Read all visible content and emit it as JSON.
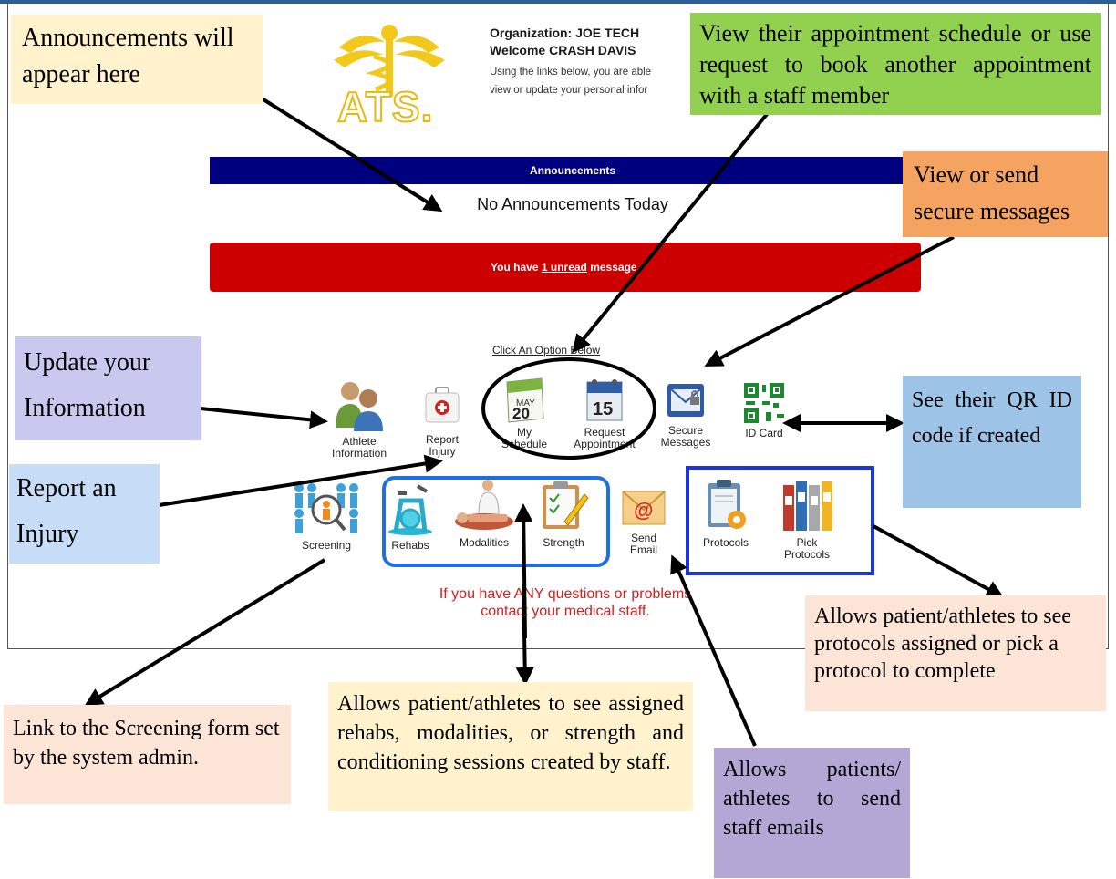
{
  "header": {
    "organization": "Organization: JOE TECH",
    "welcome": "Welcome CRASH DAVIS",
    "intro_line1": "Using the links below, you are able",
    "intro_line2": "view or update your personal infor"
  },
  "logo": {
    "text": "ATS."
  },
  "announcements": {
    "heading": "Announcements",
    "text": "No Announcements Today"
  },
  "messages": {
    "prefix": "You have ",
    "link": "1 unread",
    "suffix": " message."
  },
  "click_option": "Click An Option Below",
  "options_row1": [
    {
      "label": "Athlete\nInformation",
      "icon": "athlete-info-icon"
    },
    {
      "label": "Report\nInjury",
      "icon": "first-aid-kit-icon"
    },
    {
      "label": "My\nSchedule",
      "icon": "calendar-may-20-icon"
    },
    {
      "label": "Request\nAppointment",
      "icon": "calendar-15-icon"
    },
    {
      "label": "Secure\nMessages",
      "icon": "secure-envelope-icon"
    },
    {
      "label": "ID Card",
      "icon": "qr-code-icon"
    }
  ],
  "options_row2": [
    {
      "label": "Screening",
      "icon": "screening-people-icon"
    },
    {
      "label": "Rehabs",
      "icon": "exercise-bike-icon"
    },
    {
      "label": "Modalities",
      "icon": "doctor-patient-icon"
    },
    {
      "label": "Strength",
      "icon": "clipboard-pencil-icon"
    },
    {
      "label": "Send\nEmail",
      "icon": "email-at-icon"
    },
    {
      "label": "Protocols",
      "icon": "protocol-clipboard-icon"
    },
    {
      "label": "Pick\nProtocols",
      "icon": "binders-icon"
    }
  ],
  "contact": {
    "line1": "If you have ANY questions or problems",
    "line2": "contact your medical staff."
  },
  "callouts": {
    "announcements": "Announcements will appear here",
    "schedule": "View their appointment schedule or use request to book another appointment with a staff member",
    "messages": "View or send secure messages",
    "update": "Update your Information",
    "qr": "See their QR ID code if created",
    "injury": "Report an Injury",
    "protocols": "Allows patient/athletes to see protocols assigned or pick a protocol to complete",
    "screening": "Link to the Screening form set by the system admin.",
    "rehabs": "Allows patient/athletes to see assigned rehabs, modalities, or strength and conditioning sessions created by staff.",
    "email": "Allows patients/ athletes to send staff emails"
  },
  "colors": {
    "announcement_bar": "#00007f",
    "message_box": "#cc0000",
    "contact_text": "#d62020",
    "callout_yellow": "#fff2cc",
    "callout_green": "#92d050",
    "callout_orange": "#f4a460",
    "callout_lavender": "#c9c9f0",
    "callout_blue": "#9dc3e6",
    "callout_lightblue": "#c6dcf7",
    "callout_peach": "#fce4d6",
    "callout_purple": "#b4a7d6"
  }
}
